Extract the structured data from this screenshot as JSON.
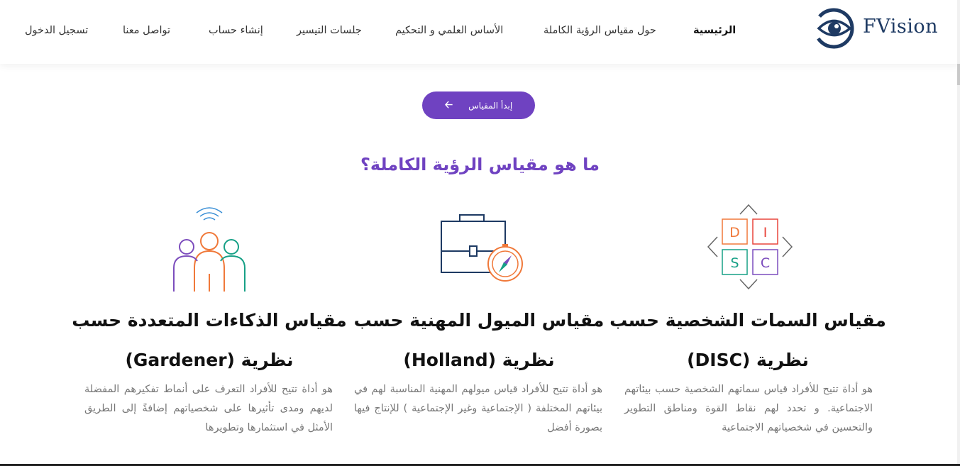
{
  "brand": {
    "name": "FVision"
  },
  "nav": {
    "items": [
      {
        "label": "الرئيسية"
      },
      {
        "label": "حول مقياس الرؤية الكاملة"
      },
      {
        "label": "الأساس العلمي و التحكيم"
      },
      {
        "label": "جلسات التيسير"
      },
      {
        "label": "إنشاء حساب"
      },
      {
        "label": "تواصل معنا"
      },
      {
        "label": "تسجيل الدخول"
      }
    ]
  },
  "hero": {
    "start_button_label": "إبدأ المقياس"
  },
  "section": {
    "title": "ما هو مقياس الرؤية الكاملة؟"
  },
  "cards": [
    {
      "title_line1": "مقياس السمات الشخصية حسب",
      "title_line2": "نظرية (DISC)",
      "description": "هو أداة تتيح للأفراد قياس سماتهم الشخصية حسب بيئاتهم الاجتماعية. و تحدد لهم نقاط القوة ومناطق التطوير والتحسين في شخصياتهم الاجتماعية",
      "icon_letters": [
        "D",
        "I",
        "S",
        "C"
      ]
    },
    {
      "title_line1": "مقياس الميول المهنية حسب",
      "title_line2": "نظرية (Holland)",
      "description": "هو أداة تتيح للأفراد قياس ميولهم المهنية المناسبة لهم في بيئاتهم المختلفة ( الإجتماعية وغير الإجتماعية ) للإنتاج فيها بصورة أفضل"
    },
    {
      "title_line1": "مقياس الذكاءات المتعددة حسب",
      "title_line2": "نظرية (Gardener)",
      "description": "هو أداة تتيح للأفراد التعرف على أنماط تفكيرهم المفضلة لديهم ومدى تأثيرها على شخصياتهم إضافةً إلى الطريق الأمثل في استثمارها وتطويرها"
    }
  ],
  "colors": {
    "accent": "#6f42c1",
    "brand_navy": "#1e3a63",
    "disc_orange": "#f0793a",
    "disc_red": "#e8453c",
    "disc_teal": "#17a086",
    "disc_purple": "#7c4dbd"
  }
}
